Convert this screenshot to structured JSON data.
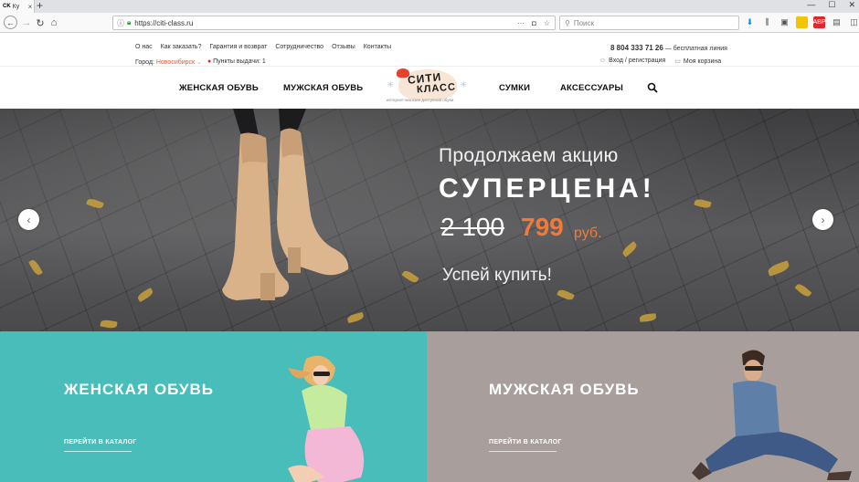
{
  "browser": {
    "tab_favicon": "CK",
    "tab_title": "Ку",
    "url": "https://citi-class.ru",
    "search_placeholder": "Поиск",
    "url_actions": [
      "···",
      "pocket-icon",
      "star-icon"
    ],
    "toolbar_icons": [
      "download-icon",
      "library-icon",
      "extension-icon",
      "addon-icon",
      "abp-icon",
      "yandex-icon",
      "sidebar-icon",
      "menu-icon"
    ]
  },
  "topbar": {
    "links": [
      "О нас",
      "Как заказать?",
      "Гарантия и возврат",
      "Сотрудничество",
      "Отзывы",
      "Контакты"
    ],
    "phone": "8 804 333 71 26",
    "phone_note": "— бесплатная линия",
    "city_label": "Город:",
    "city": "Новосибирск",
    "pickup": "Пункты выдачи: 1",
    "login": "Вход / регистрация",
    "cart": "Моя корзина"
  },
  "nav": {
    "women": "ЖЕНСКАЯ ОБУВЬ",
    "men": "МУЖСКАЯ ОБУВЬ",
    "bags": "СУМКИ",
    "accessories": "АКСЕССУАРЫ",
    "logo_line1": "СИТИ",
    "logo_line2": "КЛАСС",
    "logo_tagline": "интернет-магазин доступной обуви"
  },
  "hero": {
    "subtitle": "Продолжаем акцию",
    "title": "СУПЕРЦЕНА!",
    "old_price": "2 100",
    "new_price": "799",
    "currency": "руб.",
    "cta": "Успей купить!",
    "accent_color": "#f07a3a"
  },
  "panels": {
    "women": {
      "title": "ЖЕНСКАЯ ОБУВЬ",
      "link": "ПЕРЕЙТИ В КАТАЛОГ",
      "color": "#48bdb9"
    },
    "men": {
      "title": "МУЖСКАЯ ОБУВЬ",
      "link": "ПЕРЕЙТИ В КАТАЛОГ",
      "color": "#a89f9d"
    }
  }
}
